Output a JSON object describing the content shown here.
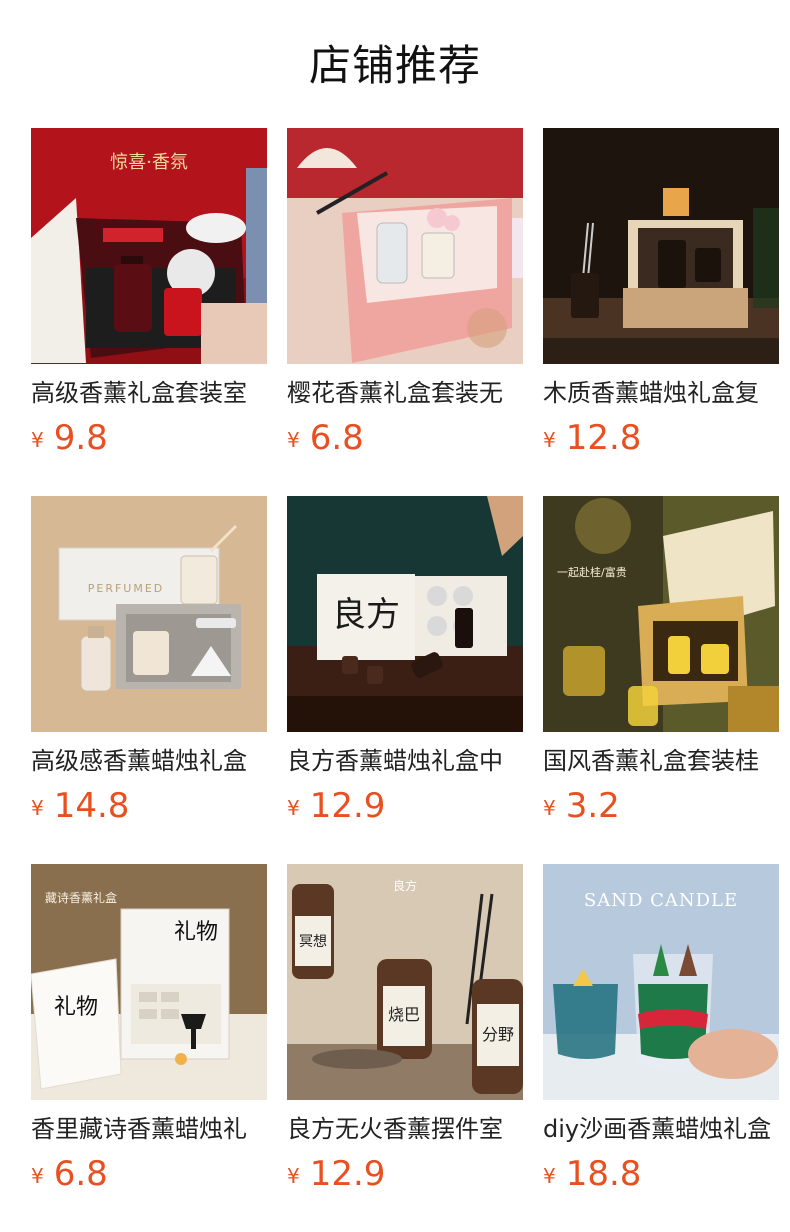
{
  "page": {
    "title": "店铺推荐",
    "currency": "¥"
  },
  "products": [
    {
      "name": "高级香薰礼盒套装室",
      "price": "9.8"
    },
    {
      "name": "樱花香薰礼盒套装无",
      "price": "6.8"
    },
    {
      "name": "木质香薰蜡烛礼盒复",
      "price": "12.8"
    },
    {
      "name": "高级感香薰蜡烛礼盒",
      "price": "14.8"
    },
    {
      "name": "良方香薰蜡烛礼盒中",
      "price": "12.9"
    },
    {
      "name": "国风香薰礼盒套装桂",
      "price": "3.2"
    },
    {
      "name": "香里藏诗香薰蜡烛礼",
      "price": "6.8"
    },
    {
      "name": "良方无火香薰摆件室",
      "price": "12.9"
    },
    {
      "name": "diy沙画香薰蜡烛礼盒",
      "price": "18.8"
    }
  ],
  "image_texts": {
    "p1_banner": "惊喜·香氛",
    "p4_box": "PERFUMED",
    "p5_box": "良方",
    "p6_tag": "一起赴桂/富贵",
    "p7_box": "礼物",
    "p7_bag": "礼物",
    "p7_tag": "藏诗香薰礼盒",
    "p8_tag": "良方",
    "p8_label1": "冥想",
    "p8_label2": "烧巴",
    "p8_label3": "分野",
    "p9_banner": "SAND CANDLE"
  },
  "colors": {
    "price": "#e8501f",
    "title": "#111111",
    "name": "#222222"
  }
}
